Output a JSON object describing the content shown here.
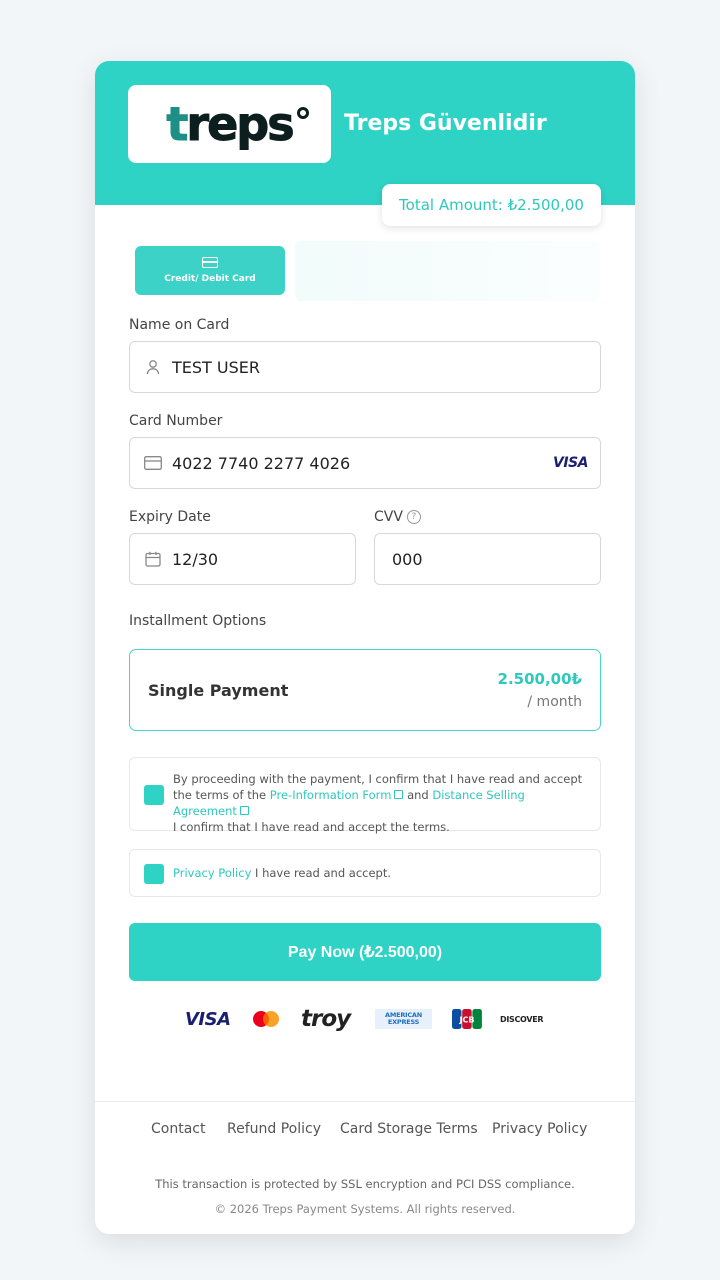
{
  "header": {
    "logo_text": "treps",
    "title": "Treps Güvenlidir",
    "total_amount": "Total Amount: ₺2.500,00"
  },
  "tabs": [
    {
      "label": "Credit/ Debit Card",
      "icon": "card-icon",
      "active": true
    }
  ],
  "form": {
    "name_label": "Name on Card",
    "name_value": "TEST USER",
    "card_label": "Card Number",
    "card_value": "4022 7740 2277 4026",
    "card_brand": "VISA",
    "expiry_label": "Expiry Date",
    "expiry_value": "12/30",
    "cvv_label": "CVV",
    "cvv_value": "000"
  },
  "installments": {
    "label": "Installment Options",
    "option_name": "Single Payment",
    "option_amount": "2.500,00₺",
    "option_period": "/ month"
  },
  "consents": {
    "terms_prefix": "By proceeding with the payment, I confirm that I have read and accept the terms of the",
    "terms_link1": "Pre-Information Form",
    "terms_and": "and",
    "terms_link2": "Distance Selling Agreement",
    "terms_suffix": "I confirm that I have read and accept the terms.",
    "privacy_link": "Privacy Policy",
    "privacy_suffix": "I have read and accept."
  },
  "pay_button": "Pay Now (₺2.500,00)",
  "payment_brands": [
    "VISA",
    "Mastercard",
    "troy",
    "AMERICAN EXPRESS",
    "JCB",
    "DISCOVER"
  ],
  "footer": {
    "links": [
      "Contact",
      "Refund Policy",
      "Card Storage Terms",
      "Privacy Policy"
    ],
    "secure_text": "This transaction is protected by SSL encryption and PCI DSS compliance.",
    "copyright": "© 2026 Treps Payment Systems. All rights reserved."
  },
  "colors": {
    "accent": "#2ed3c6",
    "accent_text": "#2ec8bc",
    "visa_blue": "#1a1f71"
  }
}
